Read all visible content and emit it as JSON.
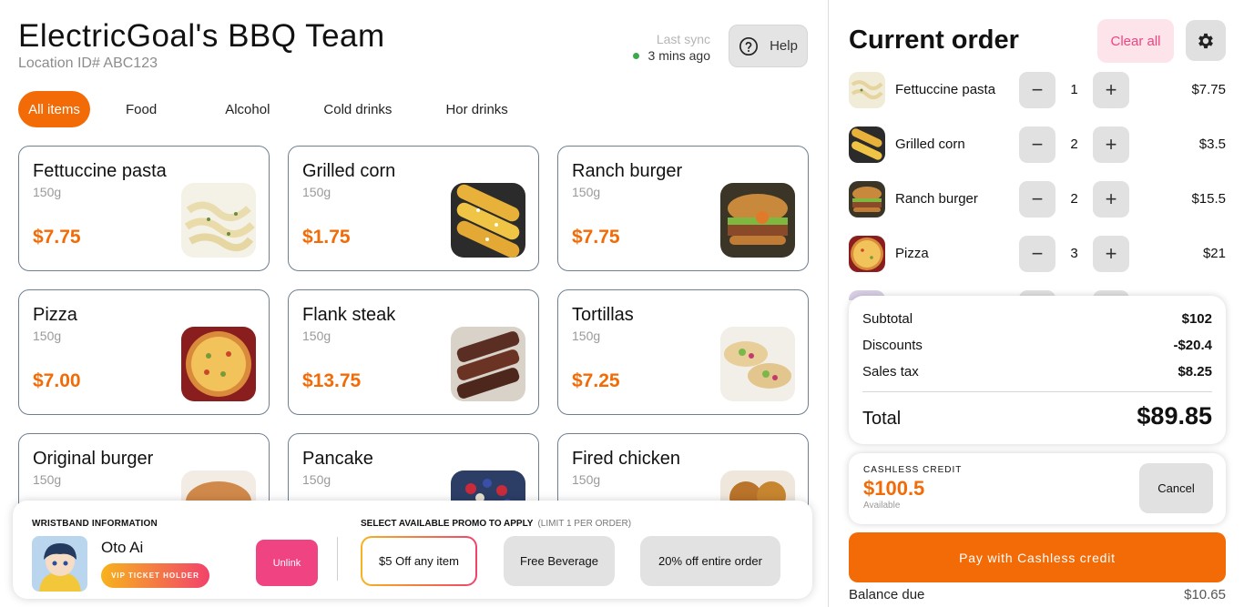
{
  "header": {
    "team_name": "ElectricGoal's BBQ Team",
    "location": "Location ID# ABC123",
    "sync_label": "Last sync",
    "sync_time": "3 mins ago",
    "help_label": "Help"
  },
  "tabs": [
    {
      "label": "All items",
      "active": true
    },
    {
      "label": "Food",
      "active": false
    },
    {
      "label": "Alcohol",
      "active": false
    },
    {
      "label": "Cold drinks",
      "active": false
    },
    {
      "label": "Hor drinks",
      "active": false
    }
  ],
  "menu": [
    {
      "name": "Fettuccine pasta",
      "weight": "150g",
      "price": "$7.75",
      "image_icon": "pasta-image"
    },
    {
      "name": "Grilled corn",
      "weight": "150g",
      "price": "$1.75",
      "image_icon": "corn-image"
    },
    {
      "name": "Ranch burger",
      "weight": "150g",
      "price": "$7.75",
      "image_icon": "burger-image"
    },
    {
      "name": "Pizza",
      "weight": "150g",
      "price": "$7.00",
      "image_icon": "pizza-image"
    },
    {
      "name": "Flank steak",
      "weight": "150g",
      "price": "$13.75",
      "image_icon": "steak-image"
    },
    {
      "name": "Tortillas",
      "weight": "150g",
      "price": "$7.25",
      "image_icon": "tortillas-image"
    },
    {
      "name": "Original burger",
      "weight": "150g",
      "price": "",
      "image_icon": "bun-image"
    },
    {
      "name": "Pancake",
      "weight": "150g",
      "price": "",
      "image_icon": "pancake-image"
    },
    {
      "name": "Fired chicken",
      "weight": "150g",
      "price": "",
      "image_icon": "chicken-image"
    }
  ],
  "wristband": {
    "label": "WRISTBAND INFORMATION",
    "name": "Oto Ai",
    "badge": "VIP TICKET HOLDER",
    "unlink_label": "Unlink"
  },
  "promos": {
    "label": "SELECT AVAILABLE PROMO TO APPLY",
    "limit": "(LIMIT 1 PER ORDER)",
    "items": [
      {
        "label": "$5 Off any item",
        "selected": true
      },
      {
        "label": "Free Beverage",
        "selected": false
      },
      {
        "label": "20% off entire order",
        "selected": false
      }
    ]
  },
  "order": {
    "title": "Current order",
    "clear_label": "Clear all",
    "items": [
      {
        "name": "Fettuccine pasta",
        "qty": "1",
        "price": "$7.75",
        "image_icon": "pasta-image"
      },
      {
        "name": "Grilled corn",
        "qty": "2",
        "price": "$3.5",
        "image_icon": "corn-image"
      },
      {
        "name": "Ranch burger",
        "qty": "2",
        "price": "$15.5",
        "image_icon": "burger-image"
      },
      {
        "name": "Pizza",
        "qty": "3",
        "price": "$21",
        "image_icon": "pizza-image"
      }
    ],
    "minus_symbol": "−",
    "plus_symbol": "+"
  },
  "summary": {
    "subtotal_label": "Subtotal",
    "subtotal": "$102",
    "discounts_label": "Discounts",
    "discounts": "-$20.4",
    "tax_label": "Sales tax",
    "tax": "$8.25",
    "total_label": "Total",
    "total": "$89.85"
  },
  "credit": {
    "label": "CASHLESS CREDIT",
    "amount": "$100.5",
    "sub": "Available",
    "cancel_label": "Cancel"
  },
  "pay": {
    "label": "Pay with Cashless credit",
    "balance_label": "Balance due",
    "balance": "$10.65"
  },
  "colors": {
    "accent": "#f26b06",
    "pink": "#f04482",
    "pink_light": "#fde3ea",
    "gray_button": "#e1e1e1"
  }
}
